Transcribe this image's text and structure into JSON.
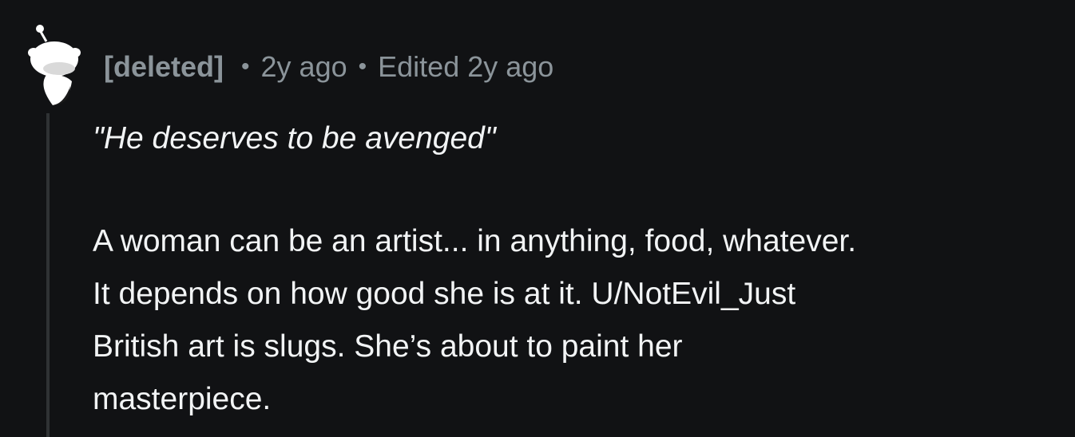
{
  "comment": {
    "author": "[deleted]",
    "separator": "•",
    "time": "2y ago",
    "edited": "Edited 2y ago",
    "quote": "\"He deserves to be avenged\"",
    "body_lines": [
      "A woman can be an artist... in anything, food, whatever.",
      "It depends on how good she is at it. U/NotEvil_Just",
      "British art is slugs. She’s about to paint her",
      "masterpiece."
    ],
    "avatar_icon": "reddit-snoo-avatar-icon"
  },
  "colors": {
    "background": "#111214",
    "text": "#f2f4f5",
    "meta": "#8b949a",
    "thread_line": "#2f3234"
  }
}
